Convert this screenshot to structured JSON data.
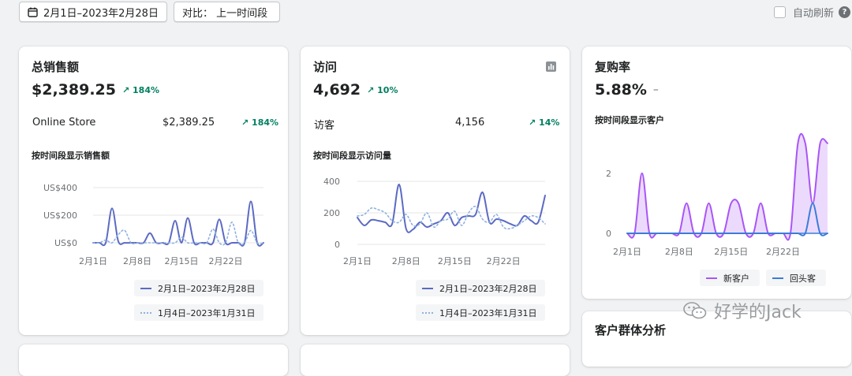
{
  "toolbar": {
    "date_range": "2月1日–2023年2月28日",
    "compare": "对比： 上一时间段",
    "auto_refresh": "自动刷新",
    "help": "?"
  },
  "sales": {
    "title": "总销售额",
    "total": "$2,389.25",
    "delta": "184%",
    "row_label": "Online Store",
    "row_value": "$2,389.25",
    "row_delta": "184%",
    "chart_title": "按时间段显示销售额",
    "legend_current": "2月1日–2023年2月28日",
    "legend_previous": "1月4日–2023年1月31日"
  },
  "visits": {
    "title": "访问",
    "total": "4,692",
    "delta": "10%",
    "row_label": "访客",
    "row_value": "4,156",
    "row_delta": "14%",
    "chart_title": "按时间段显示访问量",
    "legend_current": "2月1日–2023年2月28日",
    "legend_previous": "1月4日–2023年1月31日"
  },
  "repeat": {
    "title": "复购率",
    "total": "5.88%",
    "delta": "–",
    "chart_title": "按时间段显示客户",
    "legend_new": "新客户",
    "legend_returning": "回头客"
  },
  "cohort": {
    "title": "客户群体分析"
  },
  "watermark": {
    "text": "好学的Jack"
  },
  "colors": {
    "current": "#5c6ac4",
    "previous": "#8fb2e0",
    "new": "#a855f7",
    "returning": "#3b7dd8",
    "positive": "#007f5f"
  },
  "chart_data": [
    {
      "type": "line",
      "title": "按时间段显示销售额",
      "x": [
        1,
        2,
        3,
        4,
        5,
        6,
        7,
        8,
        9,
        10,
        11,
        12,
        13,
        14,
        15,
        16,
        17,
        18,
        19,
        20,
        21,
        22,
        23,
        24,
        25,
        26,
        27,
        28
      ],
      "x_ticks": [
        "2月1日",
        "2月8日",
        "2月15日",
        "2月22日"
      ],
      "y_ticks": [
        "US$0",
        "US$200",
        "US$400"
      ],
      "ylim": [
        0,
        480
      ],
      "series": [
        {
          "name": "2月1日–2023年2月28日",
          "values": [
            0,
            0,
            0,
            250,
            10,
            0,
            0,
            0,
            0,
            70,
            0,
            0,
            0,
            160,
            0,
            180,
            0,
            0,
            0,
            0,
            170,
            0,
            0,
            0,
            0,
            300,
            0,
            0
          ]
        },
        {
          "name": "1月4日–2023年1月31日",
          "values": [
            0,
            0,
            20,
            0,
            60,
            90,
            0,
            0,
            0,
            0,
            0,
            0,
            0,
            0,
            40,
            0,
            0,
            0,
            0,
            100,
            0,
            0,
            150,
            0,
            0,
            90,
            0,
            0
          ]
        }
      ]
    },
    {
      "type": "line",
      "title": "按时间段显示访问量",
      "x": [
        1,
        2,
        3,
        4,
        5,
        6,
        7,
        8,
        9,
        10,
        11,
        12,
        13,
        14,
        15,
        16,
        17,
        18,
        19,
        20,
        21,
        22,
        23,
        24,
        25,
        26,
        27,
        28
      ],
      "x_ticks": [
        "2月1日",
        "2月8日",
        "2月15日",
        "2月22日"
      ],
      "y_ticks": [
        "0",
        "200",
        "400"
      ],
      "ylim": [
        0,
        440
      ],
      "series": [
        {
          "name": "2月1日–2023年2月28日",
          "values": [
            170,
            120,
            155,
            150,
            140,
            130,
            380,
            100,
            95,
            140,
            110,
            130,
            150,
            200,
            120,
            170,
            180,
            190,
            330,
            140,
            160,
            150,
            130,
            120,
            180,
            150,
            140,
            310
          ]
        },
        {
          "name": "1月4日–2023年1月31日",
          "values": [
            180,
            190,
            230,
            220,
            200,
            150,
            140,
            190,
            120,
            130,
            200,
            110,
            150,
            160,
            210,
            120,
            200,
            240,
            160,
            140,
            190,
            110,
            100,
            120,
            150,
            180,
            170,
            130
          ]
        }
      ]
    },
    {
      "type": "area",
      "title": "按时间段显示客户",
      "x": [
        1,
        2,
        3,
        4,
        5,
        6,
        7,
        8,
        9,
        10,
        11,
        12,
        13,
        14,
        15,
        16,
        17,
        18,
        19,
        20,
        21,
        22,
        23,
        24,
        25,
        26,
        27,
        28
      ],
      "x_ticks": [
        "2月1日",
        "2月8日",
        "2月15日",
        "2月22日"
      ],
      "y_ticks": [
        "0",
        "2"
      ],
      "ylim": [
        0,
        3.1
      ],
      "series": [
        {
          "name": "新客户",
          "values": [
            0,
            0,
            2,
            0,
            0,
            0,
            0,
            0,
            1,
            0,
            0,
            1,
            0,
            0,
            1,
            1,
            0,
            0,
            1,
            0,
            0,
            0,
            0,
            3,
            3,
            1,
            3,
            3
          ]
        },
        {
          "name": "回头客",
          "values": [
            0,
            0,
            0,
            0,
            0,
            0,
            0,
            0,
            0,
            0,
            0,
            0,
            0,
            0,
            0,
            0,
            0,
            0,
            0,
            0,
            0,
            0,
            0,
            0,
            0,
            1,
            0,
            0
          ]
        }
      ]
    }
  ]
}
